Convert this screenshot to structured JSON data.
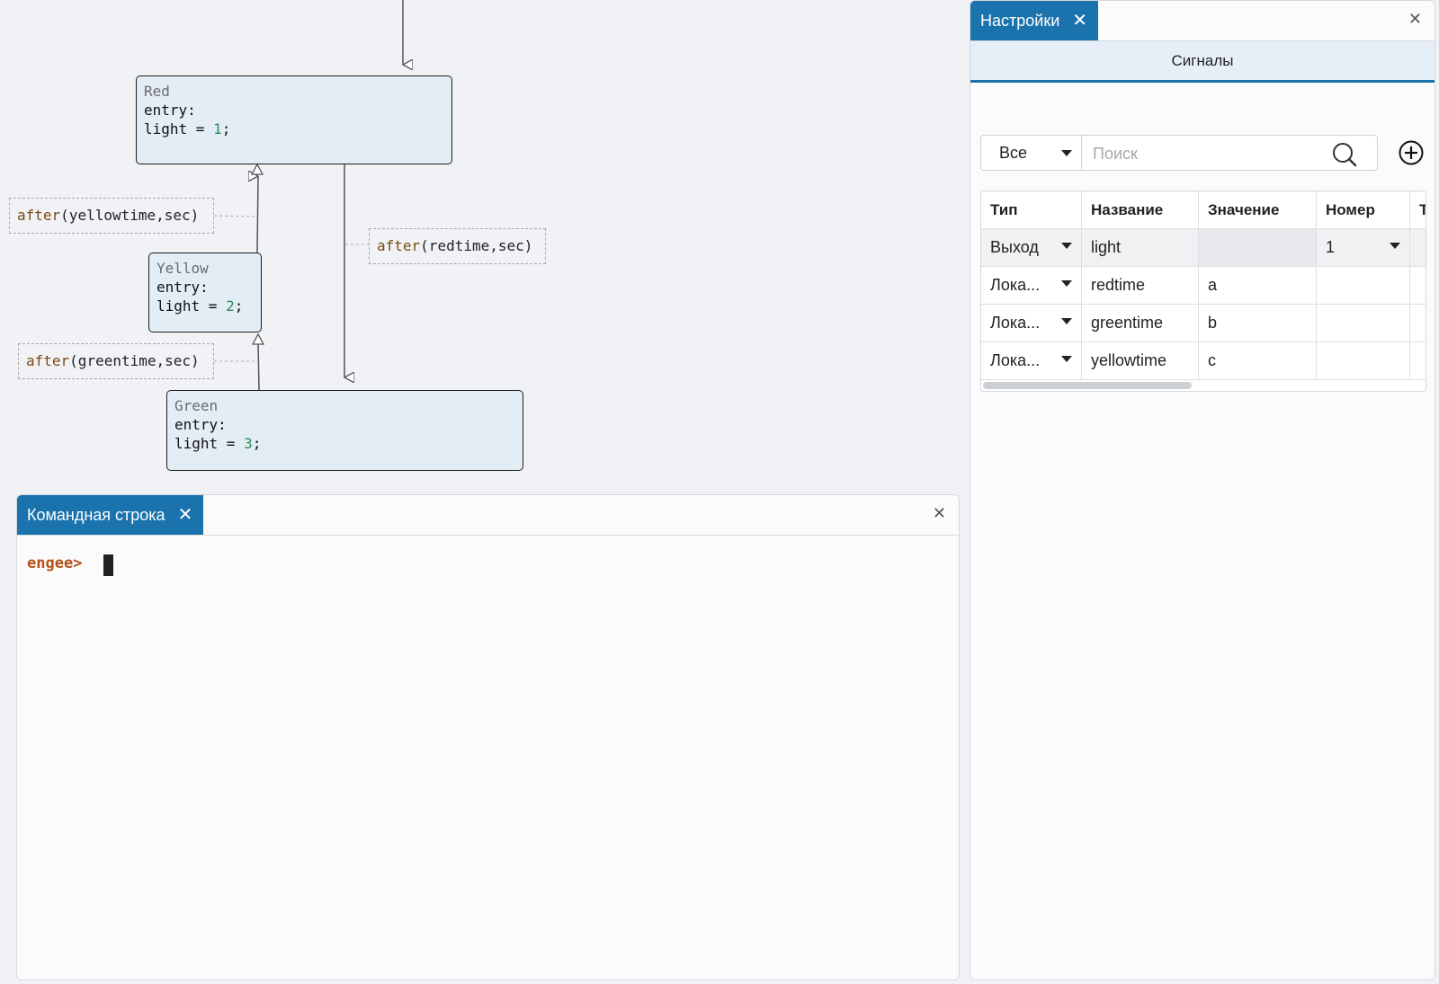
{
  "diagram": {
    "states": [
      {
        "name": "Red",
        "entry": "entry:",
        "action_prefix": "light = ",
        "action_value": "1",
        "action_suffix": ";"
      },
      {
        "name": "Yellow",
        "entry": "entry:",
        "action_prefix": "light = ",
        "action_value": "2",
        "action_suffix": ";"
      },
      {
        "name": "Green",
        "entry": "entry:",
        "action_prefix": "light = ",
        "action_value": "3",
        "action_suffix": ";"
      }
    ],
    "transitions": [
      {
        "keyword": "after",
        "args": "(yellowtime,sec)"
      },
      {
        "keyword": "after",
        "args": "(redtime,sec)"
      },
      {
        "keyword": "after",
        "args": "(greentime,sec)"
      }
    ]
  },
  "console": {
    "tab_label": "Командная строка",
    "prompt": "engee>"
  },
  "settings": {
    "tab_label": "Настройки",
    "subtab": "Сигналы",
    "filter_value": "Все",
    "search_placeholder": "Поиск",
    "columns": [
      "Тип",
      "Название",
      "Значение",
      "Номер",
      "Т"
    ],
    "rows": [
      {
        "type": "Выход",
        "name": "light",
        "value": "",
        "number": "1"
      },
      {
        "type": "Лока...",
        "name": "redtime",
        "value": "a",
        "number": ""
      },
      {
        "type": "Лока...",
        "name": "greentime",
        "value": "b",
        "number": ""
      },
      {
        "type": "Лока...",
        "name": "yellowtime",
        "value": "c",
        "number": ""
      }
    ]
  },
  "icons": {
    "tab_close": "close-icon",
    "panel_close": "close-icon",
    "dropdown": "caret-down-icon",
    "search": "search-icon",
    "add": "add-circle-icon"
  },
  "colors": {
    "accent": "#1a73ad",
    "state_fill": "#e3edf6",
    "prompt": "#b5501a",
    "number_literal": "#2e8b57"
  }
}
